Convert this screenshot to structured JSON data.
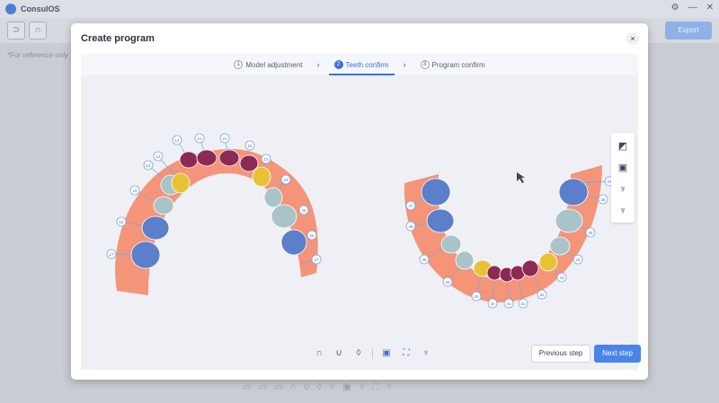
{
  "app": {
    "title": "ConsulOS"
  },
  "toolbar": {
    "export_label": "Export"
  },
  "reference_note": "*For reference only",
  "dialog": {
    "title": "Create program",
    "close_label": "×",
    "steps": [
      {
        "num": "1",
        "label": "Model adjustment"
      },
      {
        "num": "2",
        "label": "Teeth confirm"
      },
      {
        "num": "3",
        "label": "Program confirm"
      }
    ],
    "prev_label": "Previous step",
    "next_label": "Next step"
  },
  "upper_labels": [
    "17",
    "16",
    "15",
    "14",
    "13",
    "12",
    "11",
    "21",
    "22",
    "23",
    "24",
    "25",
    "26",
    "27"
  ],
  "lower_labels": [
    "47",
    "46",
    "45",
    "44",
    "43",
    "42",
    "41",
    "31",
    "32",
    "33",
    "34",
    "35",
    "36",
    "37"
  ],
  "colors": {
    "accent": "#3b73d9",
    "gum": "#f4896b",
    "molar": "#5b7fc9",
    "premolar": "#a9c4c9",
    "canine": "#e8c235",
    "incisor": "#8c2a55"
  }
}
